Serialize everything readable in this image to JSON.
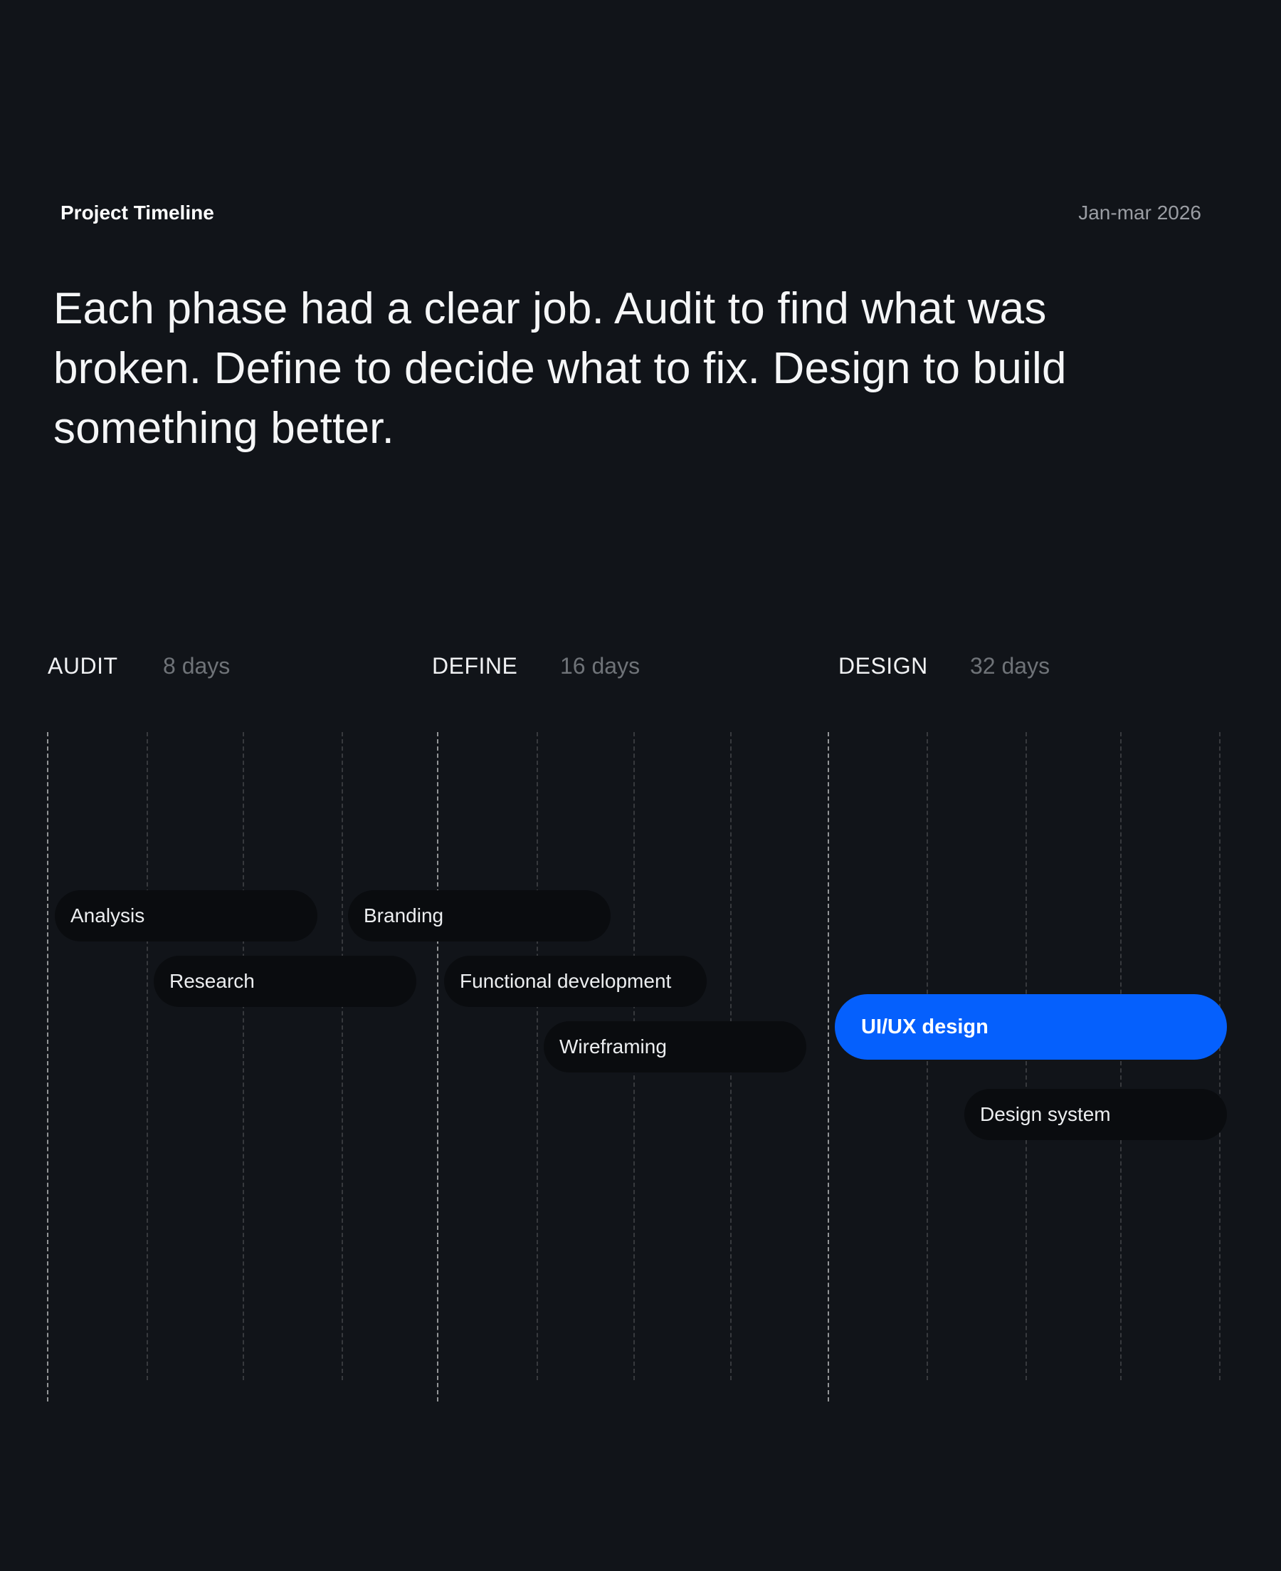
{
  "header": {
    "title": "Project Timeline",
    "date_range": "Jan-mar 2026"
  },
  "intro": {
    "text": "Each phase had a clear job. Audit to find what was broken. Define to decide what to fix. Design to build something better."
  },
  "phases": [
    {
      "name": "AUDIT",
      "duration": "8 days"
    },
    {
      "name": "DEFINE",
      "duration": "16 days"
    },
    {
      "name": "DESIGN",
      "duration": "32 days"
    }
  ],
  "tasks": [
    {
      "label": "Analysis",
      "active": false
    },
    {
      "label": "Research",
      "active": false
    },
    {
      "label": "Branding",
      "active": false
    },
    {
      "label": "Functional development",
      "active": false
    },
    {
      "label": "Wireframing",
      "active": false
    },
    {
      "label": "UI/UX design",
      "active": true
    },
    {
      "label": "Design system",
      "active": false
    }
  ],
  "colors": {
    "background": "#111419",
    "active_task": "#0560fd",
    "task": "#0a0c0f"
  }
}
